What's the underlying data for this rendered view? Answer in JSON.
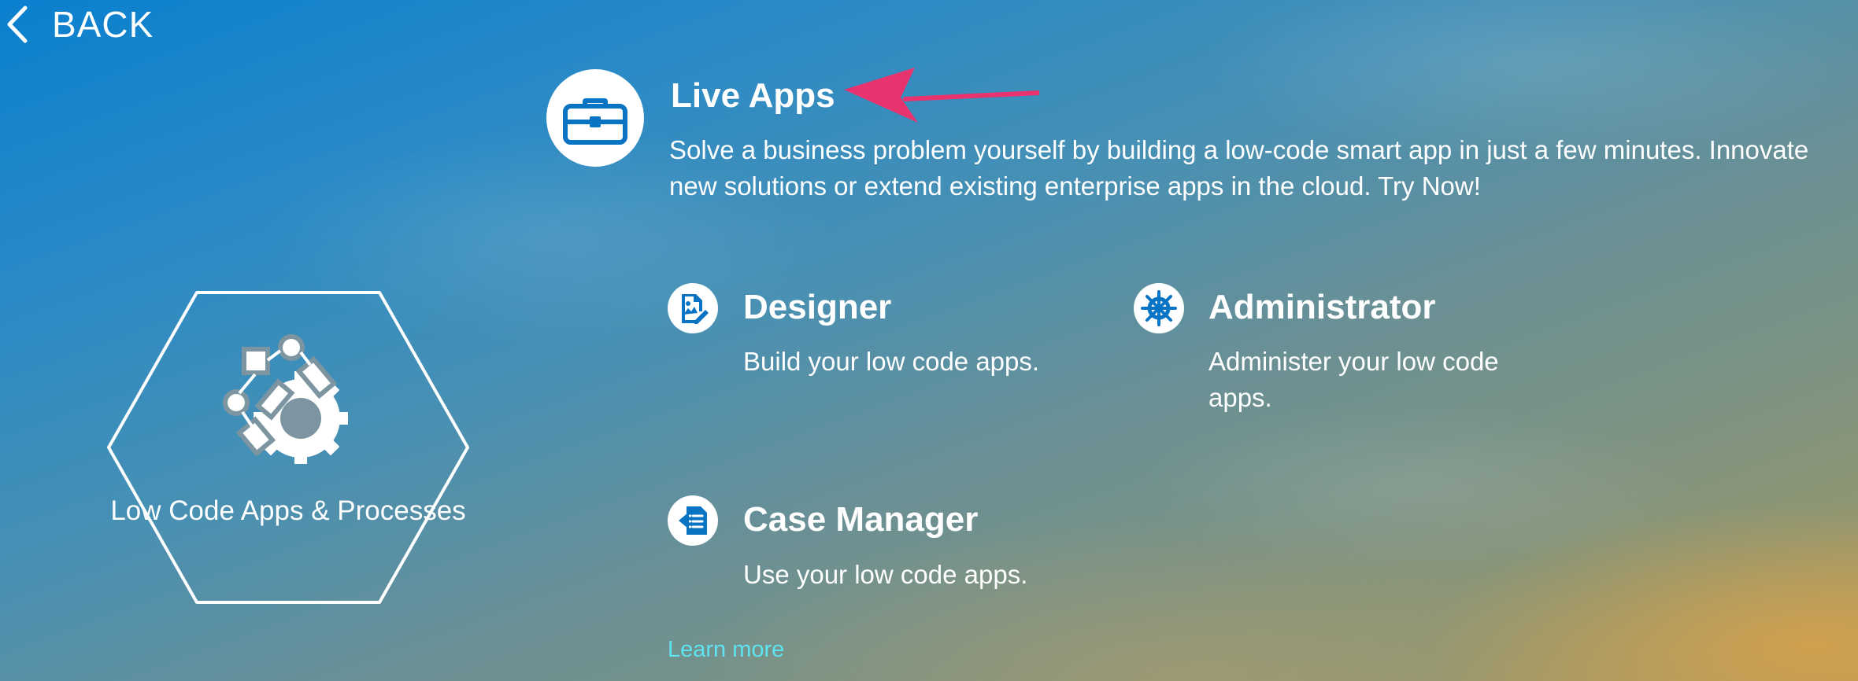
{
  "nav": {
    "back_label": "BACK",
    "back_icon": "chevron-left-icon"
  },
  "tile": {
    "label": "Low Code Apps & Processes",
    "icon": "workflow-gear-icon"
  },
  "live_apps": {
    "title": "Live Apps",
    "icon": "briefcase-icon",
    "description_line1": "Solve a business problem yourself by building a low-code smart app in just a few minutes. Innovate",
    "description_line2": "new solutions or extend existing enterprise apps in the cloud. Try Now!"
  },
  "products": [
    {
      "title": "Designer",
      "icon": "designer-edit-icon",
      "description": "Build your low code apps."
    },
    {
      "title": "Administrator",
      "icon": "helm-wheel-icon",
      "description": "Administer your low code apps."
    },
    {
      "title": "Case Manager",
      "icon": "case-document-icon",
      "description": "Use your low code apps."
    }
  ],
  "learn_more_label": "Learn more",
  "colors": {
    "icon_blue": "#0a74c4",
    "link_cyan": "#5ee3f0",
    "annotation_arrow": "#e8336e"
  }
}
